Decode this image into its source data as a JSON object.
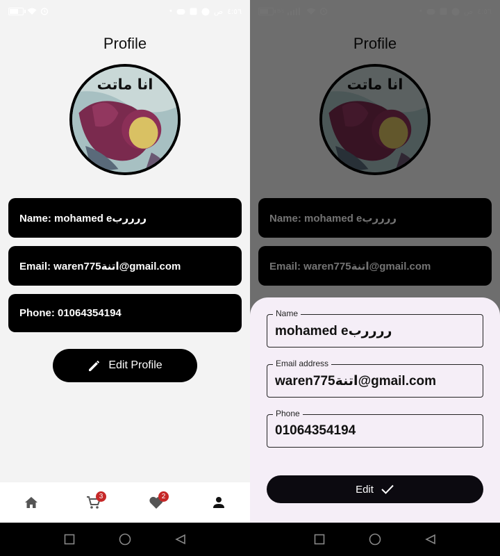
{
  "status_left": {
    "time": "٤:٥٦",
    "time_suffix": "ص"
  },
  "status_right": {
    "time": "٤:٥٦",
    "time_suffix": "ص",
    "speed": "B/s"
  },
  "profile": {
    "title": "Profile",
    "avatar_caption": "انا ماتت",
    "name_line": "Name: mohamed eررررب",
    "email_line": "Email: waren775اتنة@gmail.com",
    "phone_line": "Phone: 01064354194",
    "edit_button": "Edit Profile"
  },
  "bottom_nav": {
    "cart_badge": "3",
    "favorites_badge": "2"
  },
  "edit_sheet": {
    "name_label": "Name",
    "name_value": "mohamed eررررب",
    "email_label": "Email address",
    "email_value": "waren775اتنة@gmail.com",
    "phone_label": "Phone",
    "phone_value": "01064354194",
    "submit_label": "Edit"
  },
  "colors": {
    "background": "#f3f3f3",
    "field_bg": "#000000",
    "badge": "#c62828",
    "sheet_bg": "#f5eef7"
  }
}
